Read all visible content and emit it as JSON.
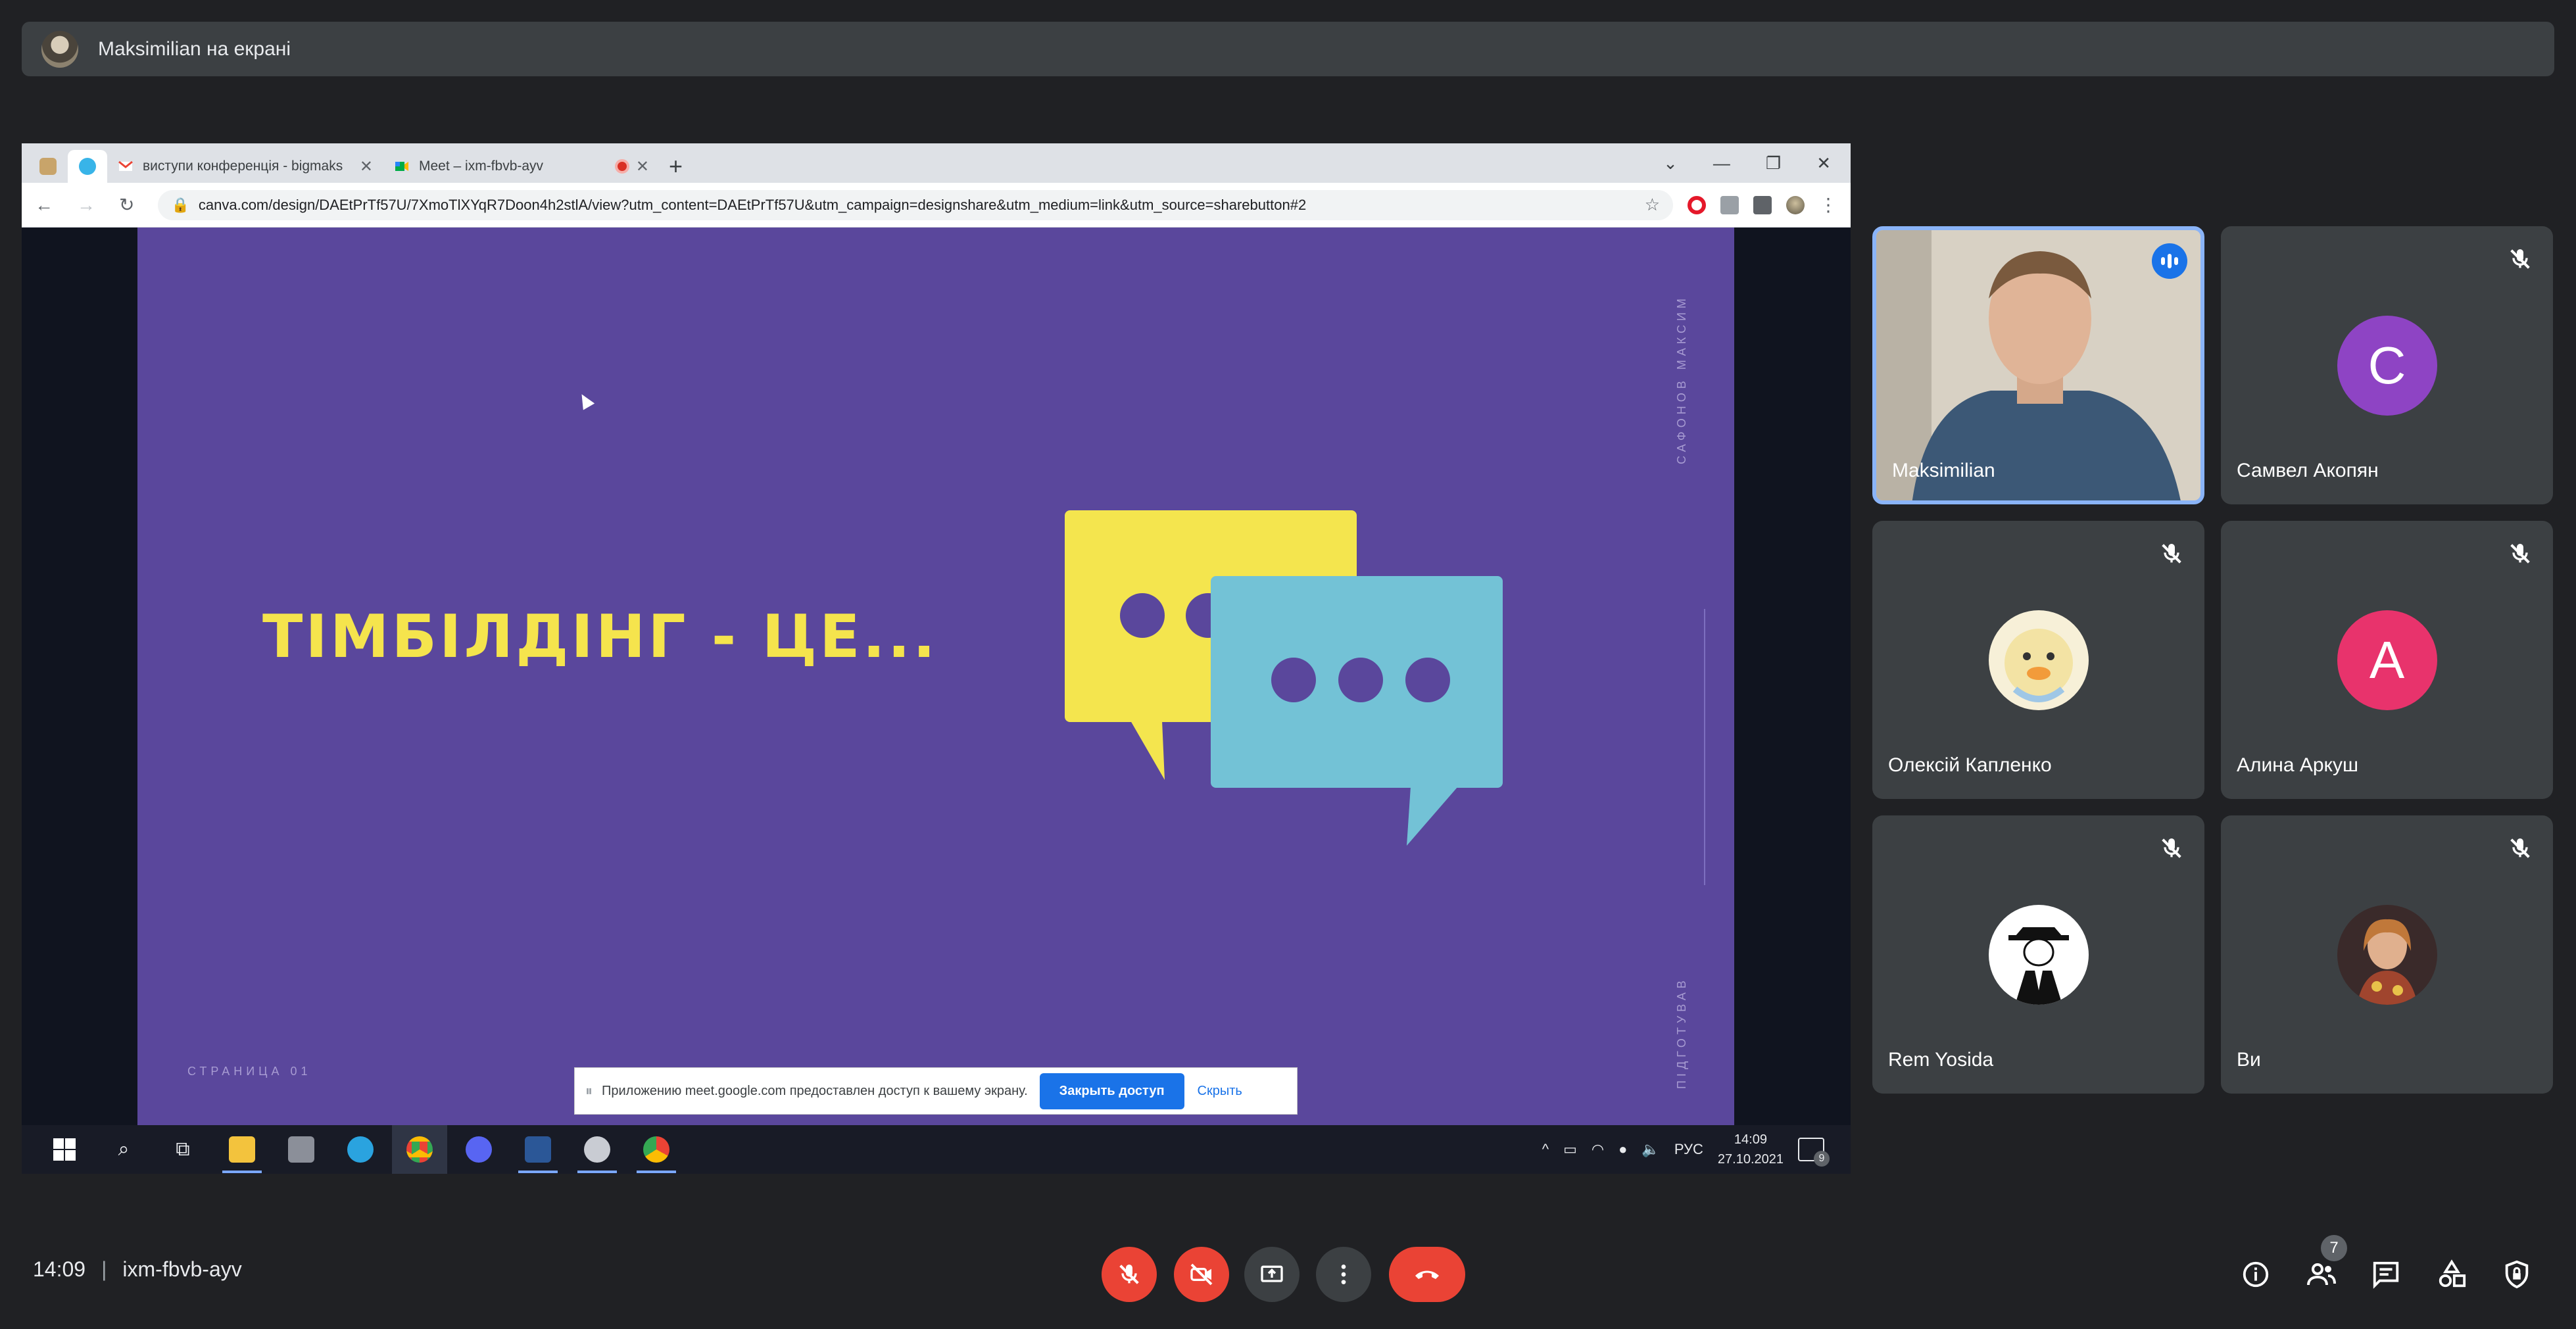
{
  "presenter_bar": {
    "text": "Maksimilian на екрані"
  },
  "browser": {
    "tabs": [
      {
        "title": "виступи конференція - bigmaks"
      },
      {
        "title": "Meet – ixm-fbvb-ayv"
      }
    ],
    "url": "canva.com/design/DAEtPrTf57U/7XmoTlXYqR7Doon4h2stlA/view?utm_content=DAEtPrTf57U&utm_campaign=designshare&utm_medium=link&utm_source=sharebutton#2"
  },
  "slide": {
    "title": "ТІМБІЛДІНГ - ЦЕ...",
    "side_top": "САФОНОВ МАКСИМ",
    "side_bottom": "ПІДГОТУВАВ",
    "page_label": "СТРАНИЦА 01"
  },
  "share_banner": {
    "text": "Приложению meet.google.com предоставлен доступ к вашему экрану.",
    "stop_label": "Закрыть доступ",
    "hide_label": "Скрыть"
  },
  "taskbar": {
    "lang": "РУС",
    "time": "14:09",
    "date": "27.10.2021",
    "notifications": "9"
  },
  "participants": [
    {
      "name": "Maksimilian"
    },
    {
      "name": "Самвел Акопян",
      "initial": "C"
    },
    {
      "name": "Олексій Капленко"
    },
    {
      "name": "Алина Аркуш",
      "initial": "A"
    },
    {
      "name": "Rem Yosida"
    },
    {
      "name": "Ви"
    }
  ],
  "meeting": {
    "time": "14:09",
    "code": "ixm-fbvb-ayv",
    "participant_count": "7"
  },
  "colors": {
    "slide_bg": "#5a479c",
    "slide_title": "#f5e44d",
    "bubble_yellow": "#f4e54e",
    "bubble_blue": "#73c2d6",
    "end_call": "#ea4335",
    "avatar_c": "#8e44c4",
    "avatar_a": "#e8336c"
  },
  "icons": [
    "mic-off-icon",
    "camera-off-icon",
    "present-icon",
    "more-options-icon",
    "end-call-icon",
    "info-icon",
    "people-icon",
    "chat-icon",
    "activities-icon",
    "host-controls-icon"
  ]
}
